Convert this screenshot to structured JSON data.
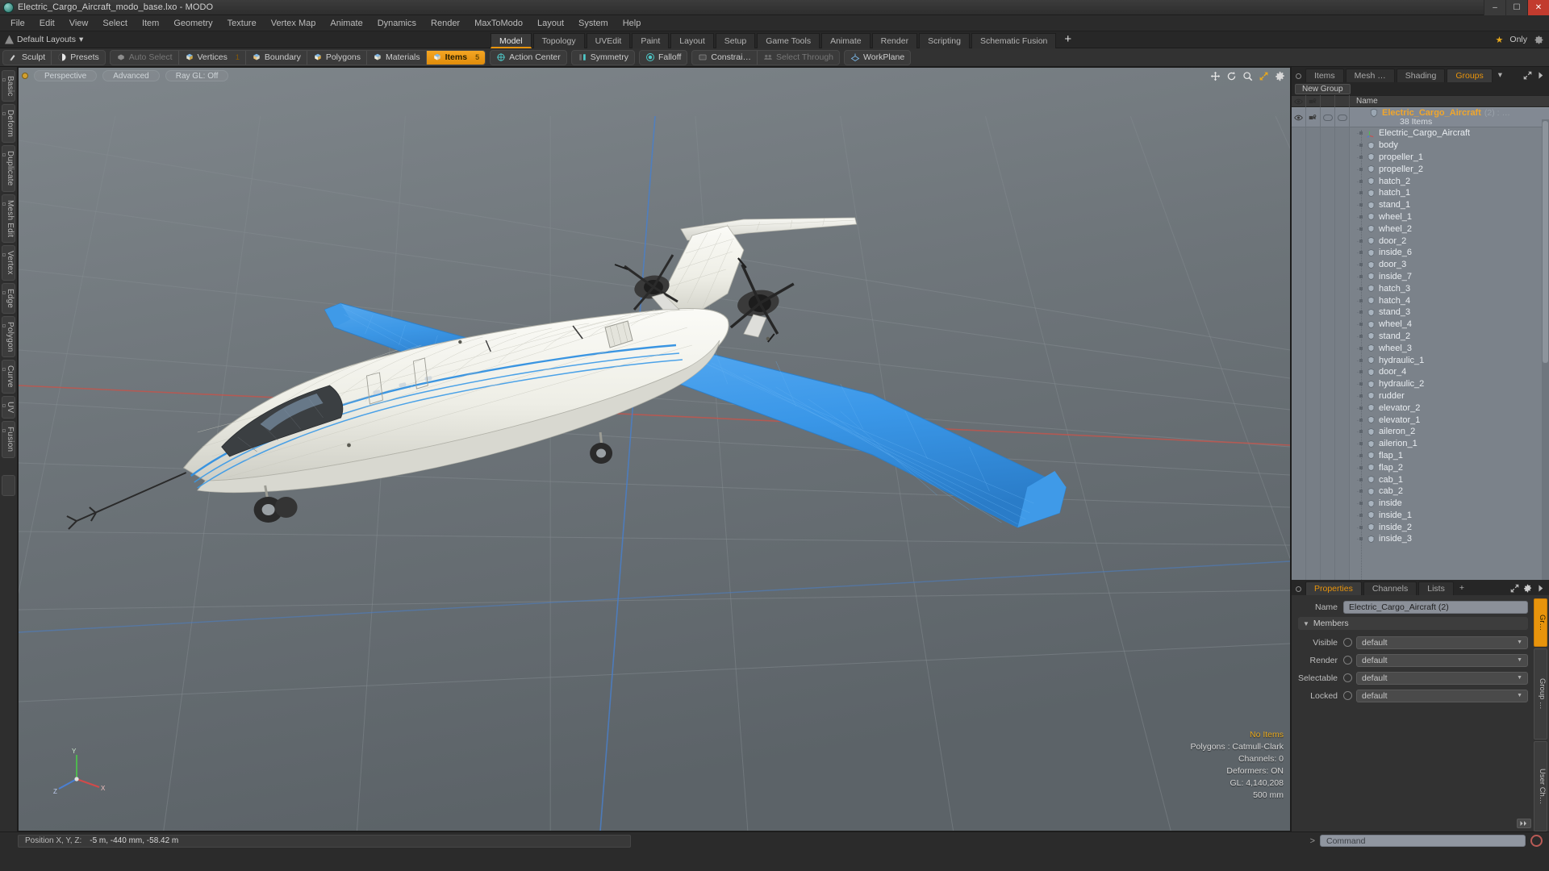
{
  "titlebar": {
    "title": "Electric_Cargo_Aircraft_modo_base.lxo - MODO",
    "app_icon": "modo-logo-icon",
    "minimize": "–",
    "maximize": "☐",
    "close": "✕"
  },
  "menubar": {
    "items": [
      "File",
      "Edit",
      "View",
      "Select",
      "Item",
      "Geometry",
      "Texture",
      "Vertex Map",
      "Animate",
      "Dynamics",
      "Render",
      "MaxToModo",
      "Layout",
      "System",
      "Help"
    ]
  },
  "layoutrow": {
    "layout_label": "Default Layouts",
    "layout_caret": "▾",
    "tabs": [
      {
        "label": "Model",
        "active": true
      },
      {
        "label": "Topology",
        "active": false
      },
      {
        "label": "UVEdit",
        "active": false
      },
      {
        "label": "Paint",
        "active": false
      },
      {
        "label": "Layout",
        "active": false
      },
      {
        "label": "Setup",
        "active": false
      },
      {
        "label": "Game Tools",
        "active": false
      },
      {
        "label": "Animate",
        "active": false
      },
      {
        "label": "Render",
        "active": false
      },
      {
        "label": "Scripting",
        "active": false
      },
      {
        "label": "Schematic Fusion",
        "active": false
      }
    ],
    "add_tab": "+",
    "star": "★",
    "only_label": "Only"
  },
  "modebar": {
    "group1": [
      {
        "label": "Sculpt",
        "icon": "sculpt-brush-icon",
        "state": "normal"
      },
      {
        "label": "Presets",
        "icon": "presets-sphere-icon",
        "state": "normal"
      }
    ],
    "group2": [
      {
        "label": "Auto Select",
        "icon": "auto-select-icon",
        "state": "dim",
        "badge": ""
      },
      {
        "label": "Vertices",
        "icon": "vertices-icon",
        "state": "normal",
        "badge": "1"
      },
      {
        "label": "Boundary",
        "icon": "boundary-icon",
        "state": "normal",
        "badge": ""
      },
      {
        "label": "Polygons",
        "icon": "polygons-icon",
        "state": "normal",
        "badge": ""
      },
      {
        "label": "Materials",
        "icon": "materials-icon",
        "state": "normal",
        "badge": ""
      },
      {
        "label": "Items",
        "icon": "items-icon",
        "state": "active",
        "badge": "5"
      }
    ],
    "group3": [
      {
        "label": "Action Center",
        "icon": "action-center-icon",
        "state": "normal"
      }
    ],
    "group4": [
      {
        "label": "Symmetry",
        "icon": "symmetry-icon",
        "state": "normal"
      }
    ],
    "group5": [
      {
        "label": "Falloff",
        "icon": "falloff-icon",
        "state": "normal"
      }
    ],
    "group6": [
      {
        "label": "Constrai…",
        "icon": "constraint-icon",
        "state": "normal"
      },
      {
        "label": "Select Through",
        "icon": "select-through-icon",
        "state": "dim"
      }
    ],
    "group7": [
      {
        "label": "WorkPlane",
        "icon": "workplane-icon",
        "state": "normal"
      }
    ]
  },
  "left_tabs": [
    "Basic",
    "Deform",
    "Duplicate",
    "Mesh Edit",
    "Vertex",
    "Edge",
    "Polygon",
    "Curve",
    "UV",
    "Fusion"
  ],
  "viewport": {
    "pills": [
      "Perspective",
      "Advanced",
      "Ray GL: Off"
    ],
    "tools": [
      "move-view-icon",
      "rotate-view-icon",
      "zoom-view-icon",
      "fit-view-icon",
      "viewport-settings-icon"
    ],
    "info": [
      {
        "text": "No Items",
        "accent": true
      },
      {
        "text": "Polygons : Catmull-Clark",
        "accent": false
      },
      {
        "text": "Channels: 0",
        "accent": false
      },
      {
        "text": "Deformers: ON",
        "accent": false
      },
      {
        "text": "GL: 4,140,208",
        "accent": false
      },
      {
        "text": "500 mm",
        "accent": false
      }
    ],
    "axis_labels": {
      "x": "X",
      "y": "Y",
      "z": "Z"
    }
  },
  "right_panel": {
    "tabs": [
      {
        "label": "Items",
        "active": false
      },
      {
        "label": "Mesh …",
        "active": false
      },
      {
        "label": "Shading",
        "active": false
      },
      {
        "label": "Groups",
        "active": true
      }
    ],
    "tab_chevron": "▾",
    "new_group_button": "New Group",
    "column_headers": [
      "visible-eye-icon",
      "render-camera-icon",
      "shaded-cube-icon",
      "wireframe-cube-icon"
    ],
    "name_header": "Name",
    "selected": {
      "name": "Electric_Cargo_Aircraft",
      "count": "(2) : …",
      "subtitle": "38 Items"
    },
    "items": [
      {
        "name": "Electric_Cargo_Aircraft",
        "icon": "locator-axis-icon"
      },
      {
        "name": "body",
        "icon": "mesh-cube-icon"
      },
      {
        "name": "propeller_1",
        "icon": "mesh-cube-icon"
      },
      {
        "name": "propeller_2",
        "icon": "mesh-cube-icon"
      },
      {
        "name": "hatch_2",
        "icon": "mesh-cube-icon"
      },
      {
        "name": "hatch_1",
        "icon": "mesh-cube-icon"
      },
      {
        "name": "stand_1",
        "icon": "mesh-cube-icon"
      },
      {
        "name": "wheel_1",
        "icon": "mesh-cube-icon"
      },
      {
        "name": "wheel_2",
        "icon": "mesh-cube-icon"
      },
      {
        "name": "door_2",
        "icon": "mesh-cube-icon"
      },
      {
        "name": "inside_6",
        "icon": "mesh-cube-icon"
      },
      {
        "name": "door_3",
        "icon": "mesh-cube-icon"
      },
      {
        "name": "inside_7",
        "icon": "mesh-cube-icon"
      },
      {
        "name": "hatch_3",
        "icon": "mesh-cube-icon"
      },
      {
        "name": "hatch_4",
        "icon": "mesh-cube-icon"
      },
      {
        "name": "stand_3",
        "icon": "mesh-cube-icon"
      },
      {
        "name": "wheel_4",
        "icon": "mesh-cube-icon"
      },
      {
        "name": "stand_2",
        "icon": "mesh-cube-icon"
      },
      {
        "name": "wheel_3",
        "icon": "mesh-cube-icon"
      },
      {
        "name": "hydraulic_1",
        "icon": "mesh-cube-icon"
      },
      {
        "name": "door_4",
        "icon": "mesh-cube-icon"
      },
      {
        "name": "hydraulic_2",
        "icon": "mesh-cube-icon"
      },
      {
        "name": "rudder",
        "icon": "mesh-cube-icon"
      },
      {
        "name": "elevator_2",
        "icon": "mesh-cube-icon"
      },
      {
        "name": "elevator_1",
        "icon": "mesh-cube-icon"
      },
      {
        "name": "aileron_2",
        "icon": "mesh-cube-icon"
      },
      {
        "name": "ailerion_1",
        "icon": "mesh-cube-icon"
      },
      {
        "name": "flap_1",
        "icon": "mesh-cube-icon"
      },
      {
        "name": "flap_2",
        "icon": "mesh-cube-icon"
      },
      {
        "name": "cab_1",
        "icon": "mesh-cube-icon"
      },
      {
        "name": "cab_2",
        "icon": "mesh-cube-icon"
      },
      {
        "name": "inside",
        "icon": "mesh-cube-icon"
      },
      {
        "name": "inside_1",
        "icon": "mesh-cube-icon"
      },
      {
        "name": "inside_2",
        "icon": "mesh-cube-icon"
      },
      {
        "name": "inside_3",
        "icon": "mesh-cube-icon"
      }
    ]
  },
  "properties": {
    "tabs": [
      {
        "label": "Properties",
        "active": true
      },
      {
        "label": "Channels",
        "active": false
      },
      {
        "label": "Lists",
        "active": false
      }
    ],
    "add_tab": "+",
    "name_label": "Name",
    "name_value": "Electric_Cargo_Aircraft (2)",
    "members_label": "Members",
    "members_triangle": "▼",
    "fields": [
      {
        "label": "Visible",
        "value": "default"
      },
      {
        "label": "Render",
        "value": "default"
      },
      {
        "label": "Selectable",
        "value": "default"
      },
      {
        "label": "Locked",
        "value": "default"
      }
    ],
    "side_tabs": [
      {
        "label": "Gr…",
        "active": true
      },
      {
        "label": "Group …",
        "active": false
      },
      {
        "label": "User Ch…",
        "active": false
      }
    ]
  },
  "bottombar": {
    "position_label": "Position X, Y, Z:",
    "position_value": "-5 m, -440 mm, -58.42 m",
    "command_prompt": ">",
    "command_placeholder": "Command"
  },
  "colors": {
    "accent": "#e8940c",
    "wing_blue": "#3399ee",
    "fuselage": "#efefe8",
    "viewport_bg": "#6d7478"
  }
}
